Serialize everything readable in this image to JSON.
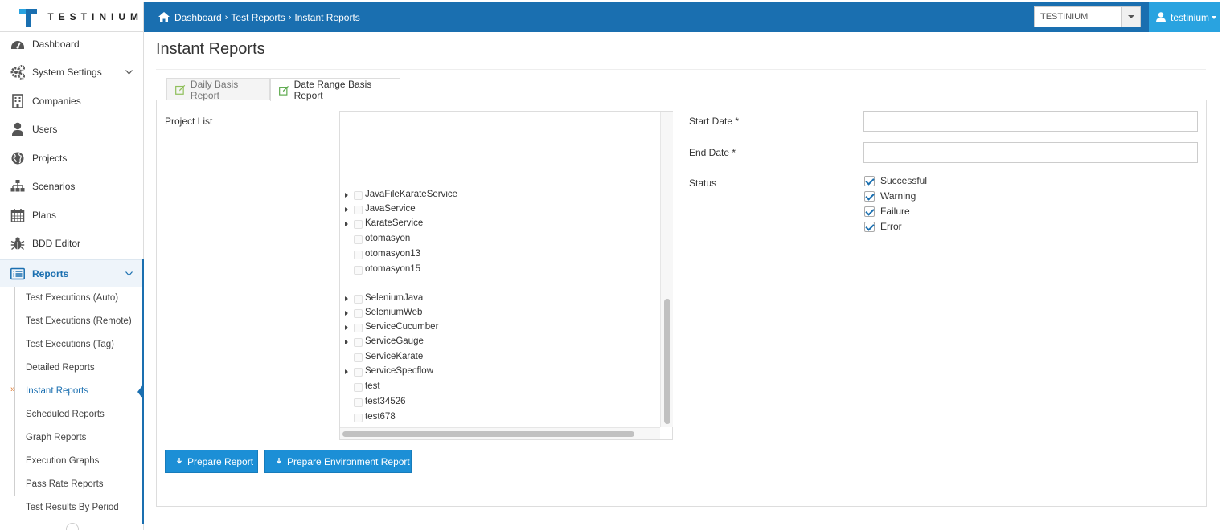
{
  "brand": {
    "name": "TESTINIUM",
    "primary": "#1a6fb0",
    "accent": "#29a3e0"
  },
  "breadcrumb": {
    "items": [
      "Dashboard",
      "Test Reports",
      "Instant Reports"
    ],
    "icon": "home-icon"
  },
  "tenant_select": {
    "value": "TESTINIUM"
  },
  "user_menu": {
    "label": "testinium",
    "icon": "user-icon"
  },
  "sidebar": {
    "items": [
      {
        "label": "Dashboard",
        "icon": "dashboard-icon"
      },
      {
        "label": "System Settings",
        "icon": "gears-icon"
      },
      {
        "label": "Companies",
        "icon": "building-icon"
      },
      {
        "label": "Users",
        "icon": "user-icon"
      },
      {
        "label": "Projects",
        "icon": "globe-icon"
      },
      {
        "label": "Scenarios",
        "icon": "sitemap-icon"
      },
      {
        "label": "Plans",
        "icon": "calendar-icon"
      },
      {
        "label": "BDD Editor",
        "icon": "bug-icon"
      },
      {
        "label": "Reports",
        "icon": "reports-icon"
      }
    ],
    "reports_submenu": [
      "Test Executions (Auto)",
      "Test Executions (Remote)",
      "Test Executions (Tag)",
      "Detailed Reports",
      "Instant Reports",
      "Scheduled Reports",
      "Graph Reports",
      "Execution Graphs",
      "Pass Rate Reports",
      "Test Results By Period"
    ],
    "current_marker": "»"
  },
  "page": {
    "title": "Instant Reports",
    "tabs": [
      {
        "label": "Daily Basis Report",
        "active": false
      },
      {
        "label": "Date Range Basis Report",
        "active": true
      }
    ]
  },
  "form": {
    "project_list_label": "Project List",
    "projects": [
      {
        "name": "JavaFileKarateService",
        "expandable": true
      },
      {
        "name": "JavaService",
        "expandable": true
      },
      {
        "name": "KarateService",
        "expandable": true
      },
      {
        "name": "otomasyon",
        "expandable": false
      },
      {
        "name": "otomasyon13",
        "expandable": false
      },
      {
        "name": "otomasyon15",
        "expandable": false
      },
      {
        "name": "SeleniumJava",
        "expandable": true
      },
      {
        "name": "SeleniumWeb",
        "expandable": true
      },
      {
        "name": "ServiceCucumber",
        "expandable": true
      },
      {
        "name": "ServiceGauge",
        "expandable": true
      },
      {
        "name": "ServiceKarate",
        "expandable": false
      },
      {
        "name": "ServiceSpecflow",
        "expandable": true
      },
      {
        "name": "test",
        "expandable": false
      },
      {
        "name": "test34526",
        "expandable": false
      },
      {
        "name": "test678",
        "expandable": false
      }
    ],
    "start_date_label": "Start Date",
    "end_date_label": "End Date",
    "required_marker": "*",
    "start_date_value": "",
    "end_date_value": "",
    "status_label": "Status",
    "statuses": [
      {
        "label": "Successful",
        "checked": true
      },
      {
        "label": "Warning",
        "checked": true
      },
      {
        "label": "Failure",
        "checked": true
      },
      {
        "label": "Error",
        "checked": true
      }
    ]
  },
  "actions": {
    "prepare_report": "Prepare Report",
    "prepare_env_report": "Prepare Environment Report"
  }
}
